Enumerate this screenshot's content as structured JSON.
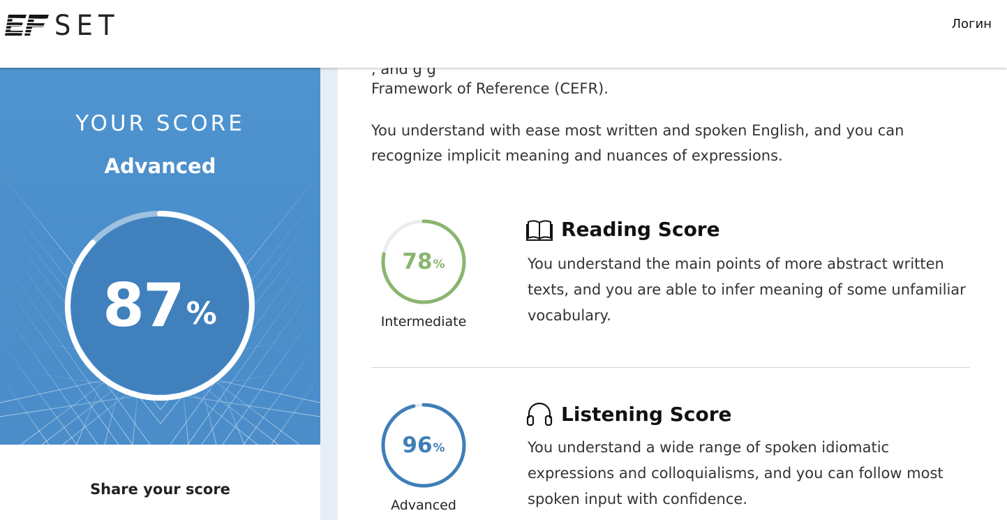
{
  "header": {
    "logo_text": "SET",
    "login_label": "Логин"
  },
  "score_panel": {
    "heading": "YOUR SCORE",
    "level": "Advanced",
    "score": "87",
    "score_unit": "%",
    "score_fraction": 0.87,
    "share_label": "Share your score"
  },
  "content": {
    "cut_text": "                , and      g     g                          ",
    "cefr_text": "Framework of Reference (CEFR).",
    "summary": "You understand with ease most written and spoken English, and you can recognize implicit meaning and nuances of expressions.",
    "sections": [
      {
        "title": "Reading Score",
        "icon": "book-icon",
        "score": "78",
        "unit": "%",
        "fraction": 0.78,
        "level": "Intermediate",
        "color": "#8ab56f",
        "description": "You understand the main points of more abstract written texts, and you are able to infer meaning of some unfamiliar vocabulary."
      },
      {
        "title": "Listening Score",
        "icon": "headphones-icon",
        "score": "96",
        "unit": "%",
        "fraction": 0.96,
        "level": "Advanced",
        "color": "#3f7fb8",
        "description": "You understand a wide range of spoken idiomatic expressions and colloquialisms, and you can follow most spoken input with confidence."
      }
    ]
  },
  "colors": {
    "hero_blue": "#4a8ecb",
    "ring_track": "#e9edf0"
  }
}
